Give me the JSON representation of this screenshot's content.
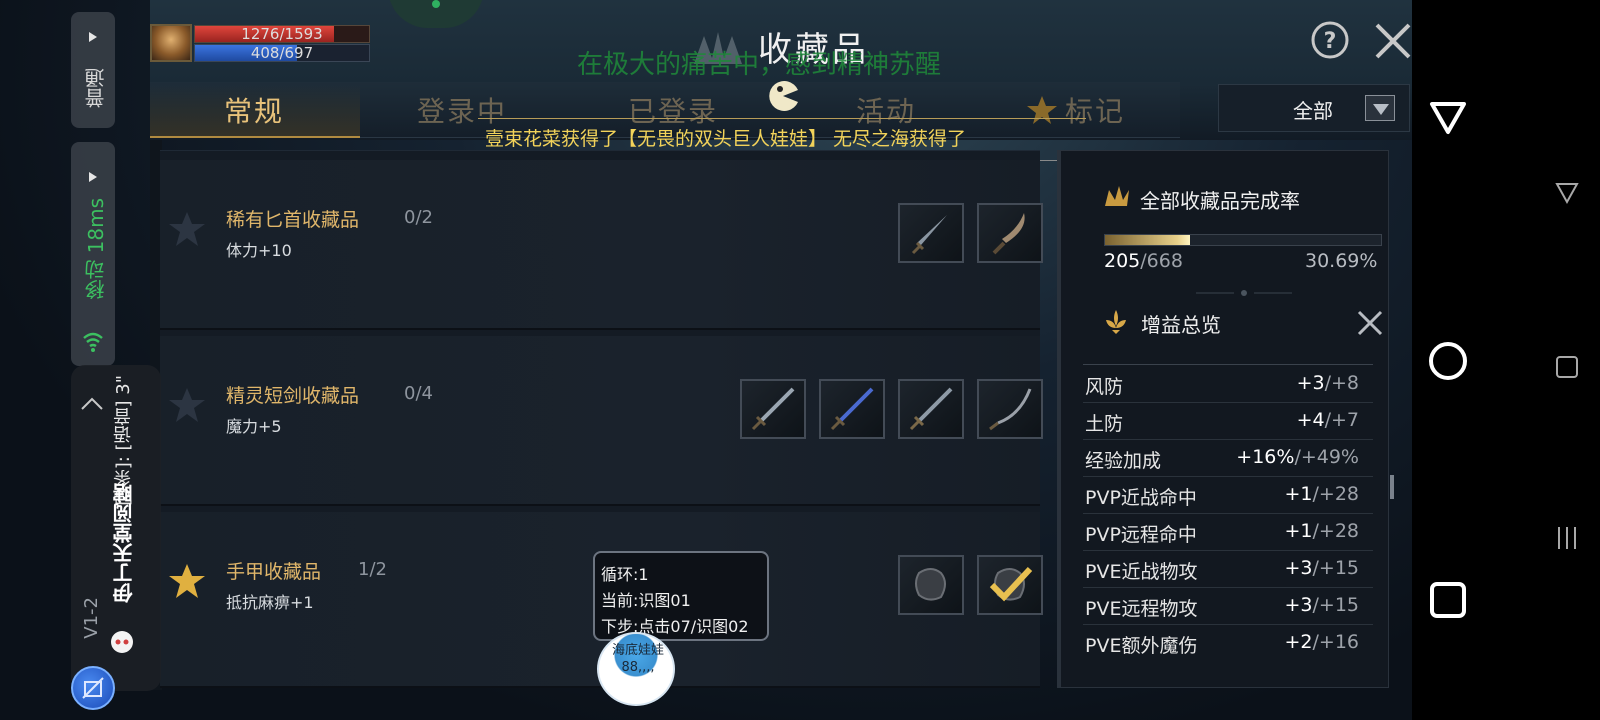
{
  "overlay": {
    "mode_label": "普通",
    "network_label": "移动 18ms",
    "voice_label": "[3条]: [语音] 3\"",
    "app_name": "伊丁天堂阅瞎",
    "version": "V1-2"
  },
  "player": {
    "hp": "1276/1593",
    "mp": "408/697",
    "hp_fraction": 0.8,
    "mp_fraction": 0.585
  },
  "window": {
    "title": "收藏品",
    "scroll_message": "在极大的痛苦中，感到精神苏醒",
    "notice": "壹束花菜获得了【无畏的双头巨人娃娃】 无尽之海获得了"
  },
  "tabs": [
    {
      "label": "常规",
      "active": true
    },
    {
      "label": "登录中",
      "active": false
    },
    {
      "label": "已登录",
      "active": false
    },
    {
      "label": "活动",
      "active": false
    },
    {
      "label": "标记",
      "active": false
    }
  ],
  "filter": {
    "selected": "全部"
  },
  "collections": [
    {
      "title": "稀有匕首收藏品",
      "count": "0/2",
      "bonus": "体力+10",
      "starred": false,
      "items": [
        "dagger-icon",
        "curved-dagger-icon"
      ]
    },
    {
      "title": "精灵短剑收藏品",
      "count": "0/4",
      "bonus": "魔力+5",
      "starred": false,
      "items": [
        "sword-icon",
        "blue-sword-icon",
        "sword-icon",
        "curved-sword-icon"
      ]
    },
    {
      "title": "手甲收藏品",
      "count": "1/2",
      "bonus": "抵抗麻痹+1",
      "starred": true,
      "items": [
        "gauntlet-icon",
        "gauntlet-collected-icon"
      ]
    }
  ],
  "tooltip": {
    "line1": "循环:1",
    "line2": "当前:识图01",
    "line3": "下步:点击07/识图02"
  },
  "bubble": {
    "text": "海底娃娃88,,,,"
  },
  "completion": {
    "title": "全部收藏品完成率",
    "current": "205",
    "total": "/668",
    "percent": "30.69%",
    "fraction": 0.3069
  },
  "buffs": {
    "title": "增益总览",
    "items": [
      {
        "name": "风防",
        "value": "+3",
        "max": "/+8"
      },
      {
        "name": "土防",
        "value": "+4",
        "max": "/+7"
      },
      {
        "name": "经验加成",
        "value": "+16%",
        "max": "/+49%"
      },
      {
        "name": "PVP近战命中",
        "value": "+1",
        "max": "/+28"
      },
      {
        "name": "PVP远程命中",
        "value": "+1",
        "max": "/+28"
      },
      {
        "name": "PVE近战物攻",
        "value": "+3",
        "max": "/+15"
      },
      {
        "name": "PVE远程物攻",
        "value": "+3",
        "max": "/+15"
      },
      {
        "name": "PVE额外魔伤",
        "value": "+2",
        "max": "/+16"
      }
    ]
  },
  "colors": {
    "gold": "#e0b66a",
    "hp_bar": "#c8342c",
    "mp_bar": "#2f63c8",
    "nav_bg": "#000000"
  }
}
